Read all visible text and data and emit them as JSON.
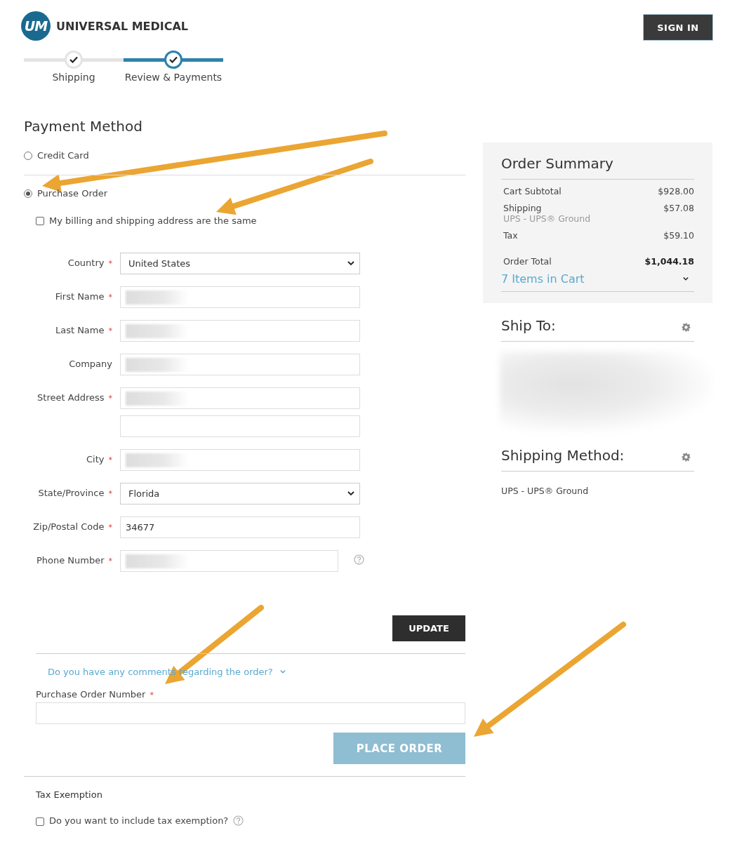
{
  "header": {
    "logo_mark": "UM",
    "brand": "UNIVERSAL MEDICAL",
    "sign_in": "SIGN IN"
  },
  "steps": [
    {
      "label": "Shipping",
      "done": true,
      "selected": false
    },
    {
      "label": "Review & Payments",
      "done": true,
      "selected": true
    }
  ],
  "payment": {
    "title": "Payment Method",
    "methods": [
      {
        "label": "Credit Card",
        "selected": false
      },
      {
        "label": "Purchase Order",
        "selected": true
      }
    ],
    "same_address": {
      "label": "My billing and shipping address are the same",
      "checked": false
    },
    "fields": [
      {
        "kind": "select",
        "label": "Country",
        "required_mark": "*",
        "value": "United States"
      },
      {
        "kind": "text",
        "label": "First Name",
        "required_mark": "*",
        "redacted": true
      },
      {
        "kind": "text",
        "label": "Last Name",
        "required_mark": "*",
        "redacted": true
      },
      {
        "kind": "text",
        "label": "Company",
        "redacted": true
      },
      {
        "kind": "text",
        "label": "Street Address",
        "required_mark": "*",
        "redacted": true
      },
      {
        "kind": "text"
      },
      {
        "kind": "text",
        "label": "City",
        "required_mark": "*",
        "redacted": true
      },
      {
        "kind": "select",
        "label": "State/Province",
        "required_mark": "*",
        "value": "Florida"
      },
      {
        "kind": "text",
        "label": "Zip/Postal Code",
        "required_mark": "*",
        "value": "34677"
      },
      {
        "kind": "text",
        "label": "Phone Number",
        "required_mark": "*",
        "redacted": true,
        "help": true
      }
    ],
    "update": "UPDATE",
    "comments_link": {
      "label": "Do you have any comments regarding the order?",
      "expanded": false
    },
    "po_number": {
      "label": "Purchase Order Number",
      "required_mark": "*"
    },
    "place_order": {
      "label": "PLACE ORDER",
      "disabled": true
    },
    "tax_exemption": {
      "title": "Tax Exemption",
      "label": "Do you want to include tax exemption?",
      "checked": false,
      "help": true
    }
  },
  "summary": {
    "title": "Order Summary",
    "rows": [
      {
        "kind": "line",
        "label": "Cart Subtotal",
        "amount": "$928.00"
      },
      {
        "kind": "line",
        "label": "Shipping",
        "note": "UPS - UPS® Ground",
        "amount": "$57.08"
      },
      {
        "kind": "line",
        "label": "Tax",
        "amount": "$59.10"
      },
      {
        "kind": "total",
        "label": "Order Total",
        "amount": "$1,044.18"
      }
    ],
    "items_in_cart": {
      "label": "7 Items in Cart",
      "expanded": false
    }
  },
  "ship_to": {
    "title": "Ship To:",
    "redacted": true
  },
  "shipping_method": {
    "title": "Shipping Method:",
    "value": "UPS - UPS® Ground"
  }
}
